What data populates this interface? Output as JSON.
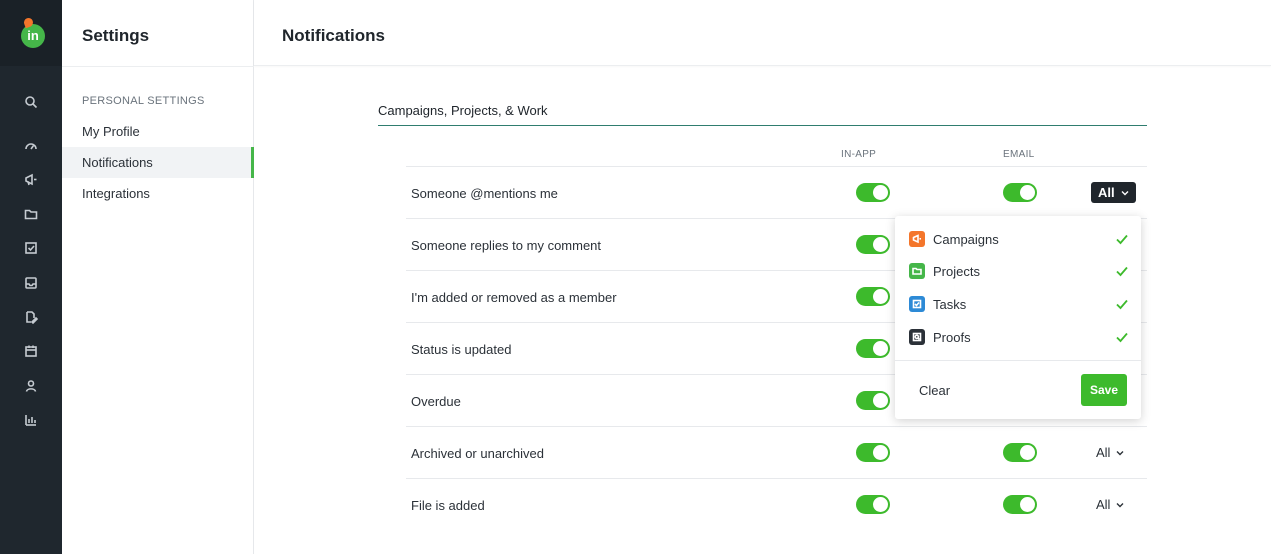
{
  "colors": {
    "rail_bg": "#1f272e",
    "accent_green": "#3dba2c",
    "campaigns": "#f4762b",
    "projects": "#45b649",
    "tasks": "#2d8ad6",
    "proofs": "#2b3138"
  },
  "rail": {
    "logo_text": "in",
    "icons": [
      "search-icon",
      "dashboard-icon",
      "megaphone-icon",
      "folder-icon",
      "checkbox-icon",
      "inbox-icon",
      "proof-edit-icon",
      "calendar-icon",
      "user-icon",
      "bar-chart-icon"
    ]
  },
  "settings": {
    "title": "Settings",
    "section_label": "PERSONAL SETTINGS",
    "items": [
      {
        "label": "My Profile"
      },
      {
        "label": "Notifications"
      },
      {
        "label": "Integrations"
      }
    ]
  },
  "main": {
    "title": "Notifications",
    "group_title": "Campaigns, Projects, & Work",
    "col_inapp": "IN-APP",
    "col_email": "EMAIL",
    "rows": [
      {
        "label": "Someone @mentions me",
        "all": "All"
      },
      {
        "label": "Someone replies to my comment",
        "all": ""
      },
      {
        "label": "I'm added or removed as a member",
        "all": ""
      },
      {
        "label": "Status is updated",
        "all": ""
      },
      {
        "label": "Overdue",
        "all": ""
      },
      {
        "label": "Archived or unarchived",
        "all": "All"
      },
      {
        "label": "File is added",
        "all": "All"
      }
    ]
  },
  "popover": {
    "items": [
      {
        "label": "Campaigns"
      },
      {
        "label": "Projects"
      },
      {
        "label": "Tasks"
      },
      {
        "label": "Proofs"
      }
    ],
    "clear_label": "Clear",
    "save_label": "Save"
  }
}
